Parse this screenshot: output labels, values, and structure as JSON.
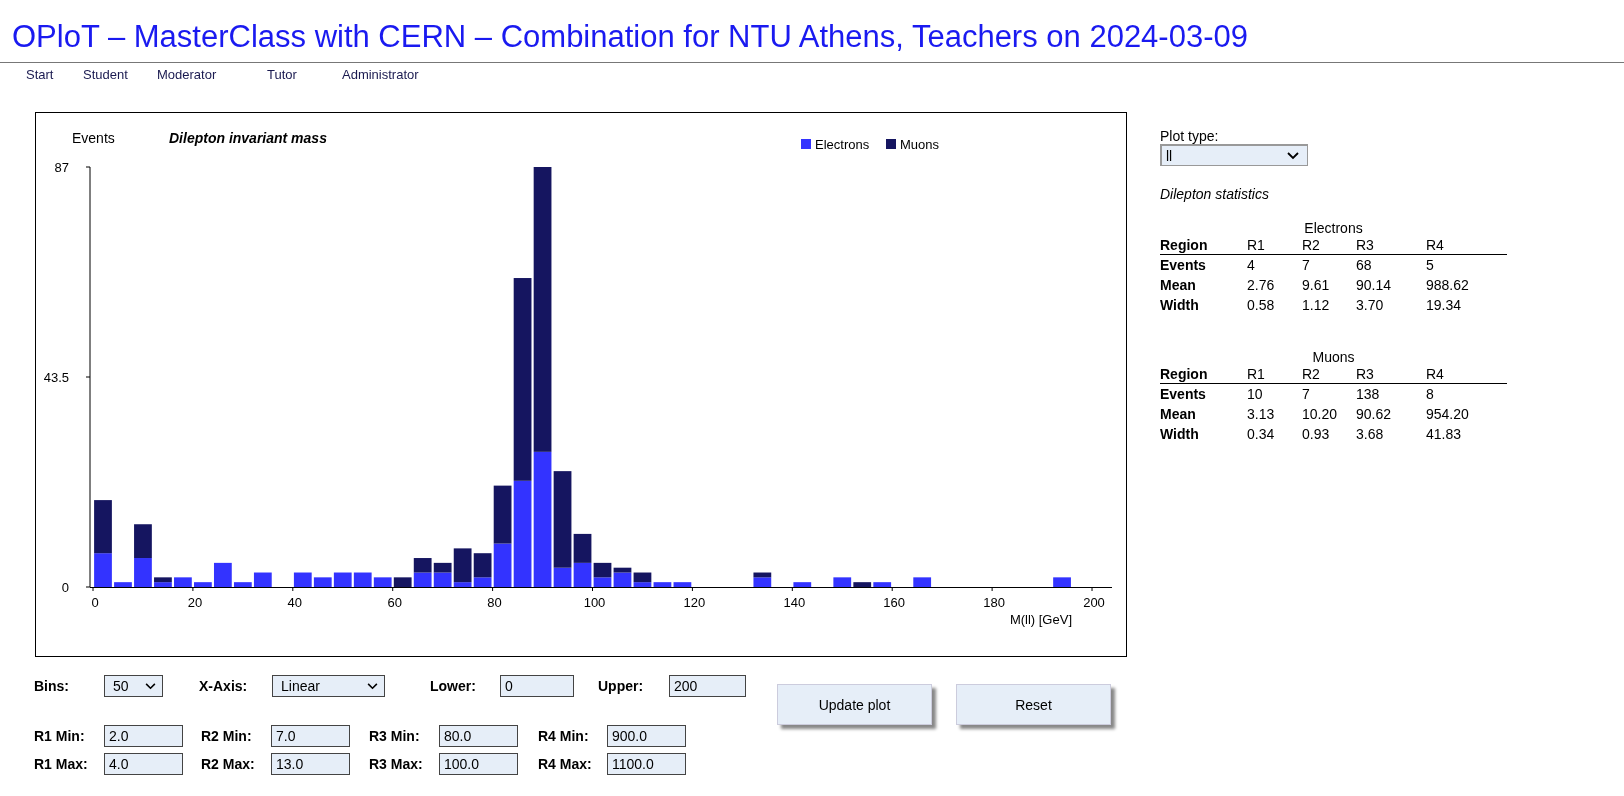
{
  "header": {
    "title": "OPloT – MasterClass with CERN – Combination for NTU Athens, Teachers on 2024-03-09"
  },
  "nav": [
    {
      "label": "Start"
    },
    {
      "label": "Student"
    },
    {
      "label": "Moderator"
    },
    {
      "label": "Tutor"
    },
    {
      "label": "Administrator"
    }
  ],
  "chart": {
    "chart_data": {
      "type": "bar",
      "stacked": true,
      "legend": true,
      "title": "Dilepton invariant mass",
      "xlabel": "M(ll) [GeV]",
      "ylabel": "Events",
      "xlim": [
        0,
        204
      ],
      "ylim": [
        0,
        87
      ],
      "xticks": [
        0,
        20,
        40,
        60,
        80,
        100,
        120,
        140,
        160,
        180,
        200
      ],
      "yticks": [
        0,
        43.5,
        87
      ],
      "x": [
        2,
        6,
        10,
        14,
        18,
        22,
        26,
        30,
        34,
        38,
        42,
        46,
        50,
        54,
        58,
        62,
        66,
        70,
        74,
        78,
        82,
        86,
        90,
        94,
        98,
        102,
        106,
        110,
        114,
        118,
        122,
        126,
        130,
        134,
        138,
        142,
        146,
        150,
        154,
        158,
        162,
        166,
        170,
        174,
        178,
        182,
        186,
        190,
        194,
        198
      ],
      "series": [
        {
          "name": "Electrons",
          "color": "#3333ff",
          "values": [
            7,
            1,
            6,
            1,
            2,
            1,
            5,
            1,
            3,
            0,
            3,
            2,
            3,
            3,
            2,
            0,
            3,
            3,
            1,
            2,
            9,
            22,
            28,
            4,
            5,
            2,
            3,
            1,
            1,
            1,
            0,
            0,
            0,
            2,
            0,
            1,
            0,
            2,
            0,
            1,
            0,
            2,
            0,
            0,
            0,
            0,
            0,
            0,
            2,
            0
          ]
        },
        {
          "name": "Muons",
          "color": "#151560",
          "values": [
            11,
            0,
            7,
            1,
            0,
            0,
            0,
            0,
            0,
            0,
            0,
            0,
            0,
            0,
            0,
            2,
            3,
            2,
            7,
            5,
            12,
            42,
            59,
            20,
            6,
            3,
            1,
            2,
            0,
            0,
            0,
            0,
            0,
            1,
            0,
            0,
            0,
            0,
            1,
            0,
            0,
            0,
            0,
            0,
            0,
            0,
            0,
            0,
            0,
            0
          ]
        }
      ]
    }
  },
  "side": {
    "plot_type": {
      "label": "Plot type:",
      "value": "ll"
    },
    "stats_title": "Dilepton statistics",
    "tables": [
      {
        "title": "Electrons",
        "columns": [
          "Region",
          "R1",
          "R2",
          "R3",
          "R4"
        ],
        "rows": [
          {
            "label": "Events",
            "values": [
              "4",
              "7",
              "68",
              "5"
            ]
          },
          {
            "label": "Mean",
            "values": [
              "2.76",
              "9.61",
              "90.14",
              "988.62"
            ]
          },
          {
            "label": "Width",
            "values": [
              "0.58",
              "1.12",
              "3.70",
              "19.34"
            ]
          }
        ]
      },
      {
        "title": "Muons",
        "columns": [
          "Region",
          "R1",
          "R2",
          "R3",
          "R4"
        ],
        "rows": [
          {
            "label": "Events",
            "values": [
              "10",
              "7",
              "138",
              "8"
            ]
          },
          {
            "label": "Mean",
            "values": [
              "3.13",
              "10.20",
              "90.62",
              "954.20"
            ]
          },
          {
            "label": "Width",
            "values": [
              "0.34",
              "0.93",
              "3.68",
              "41.83"
            ]
          }
        ]
      }
    ]
  },
  "controls": {
    "settings": [
      {
        "label": "Bins:",
        "kind": "select",
        "value": "50"
      },
      {
        "label": "X-Axis:",
        "kind": "select",
        "value": "Linear"
      },
      {
        "label": "Lower:",
        "kind": "input",
        "value": "0"
      },
      {
        "label": "Upper:",
        "kind": "input",
        "value": "200"
      }
    ],
    "regions": [
      {
        "label": "R1 Min:",
        "value": "2.0"
      },
      {
        "label": "R2 Min:",
        "value": "7.0"
      },
      {
        "label": "R3 Min:",
        "value": "80.0"
      },
      {
        "label": "R4 Min:",
        "value": "900.0"
      },
      {
        "label": "R1 Max:",
        "value": "4.0"
      },
      {
        "label": "R2 Max:",
        "value": "13.0"
      },
      {
        "label": "R3 Max:",
        "value": "100.0"
      },
      {
        "label": "R4 Max:",
        "value": "1100.0"
      }
    ],
    "buttons": [
      {
        "label": "Update plot"
      },
      {
        "label": "Reset"
      }
    ]
  }
}
